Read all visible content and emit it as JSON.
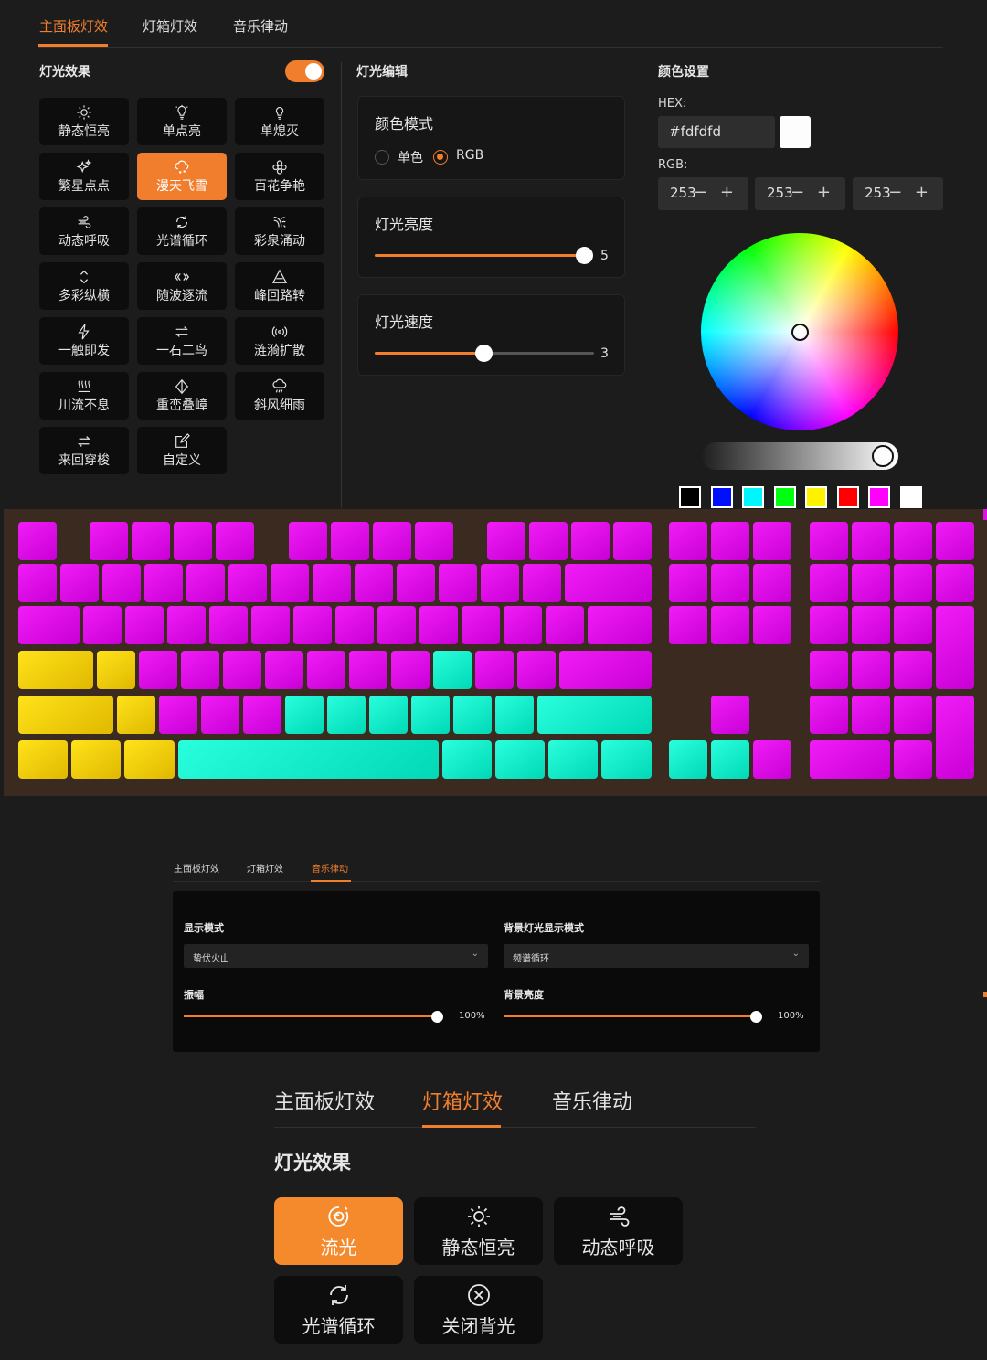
{
  "colors": {
    "accent": "#f07e2d",
    "magenta": "#e010ea",
    "cyan": "#1af0cf",
    "yellow": "#f5cf0a"
  },
  "main_panel": {
    "tabs": [
      {
        "label": "主面板灯效"
      },
      {
        "label": "灯箱灯效"
      },
      {
        "label": "音乐律动"
      }
    ],
    "active_tab": "主面板灯效",
    "effects": {
      "title": "灯光效果",
      "enabled": true,
      "items": [
        {
          "label": "静态恒亮",
          "icon": "sun-icon"
        },
        {
          "label": "单点亮",
          "icon": "bulb-icon"
        },
        {
          "label": "单熄灭",
          "icon": "bulb-off-icon"
        },
        {
          "label": "繁星点点",
          "icon": "sparkle-icon"
        },
        {
          "label": "漫天飞雪",
          "icon": "snow-cloud-icon",
          "active": true
        },
        {
          "label": "百花争艳",
          "icon": "flower-icon"
        },
        {
          "label": "动态呼吸",
          "icon": "wind-icon"
        },
        {
          "label": "光谱循环",
          "icon": "cycle-icon"
        },
        {
          "label": "彩泉涌动",
          "icon": "fountain-icon"
        },
        {
          "label": "多彩纵横",
          "icon": "up-down-icon"
        },
        {
          "label": "随波逐流",
          "icon": "wave-arrows-icon"
        },
        {
          "label": "峰回路转",
          "icon": "triangle-icon"
        },
        {
          "label": "一触即发",
          "icon": "lightning-icon"
        },
        {
          "label": "一石二鸟",
          "icon": "swap-arrows-icon"
        },
        {
          "label": "涟漪扩散",
          "icon": "ripple-icon"
        },
        {
          "label": "川流不息",
          "icon": "stream-icon"
        },
        {
          "label": "重峦叠嶂",
          "icon": "layers-icon"
        },
        {
          "label": "斜风细雨",
          "icon": "rain-cloud-icon"
        },
        {
          "label": "来回穿梭",
          "icon": "shuttle-icon"
        },
        {
          "label": "自定义",
          "icon": "edit-icon"
        }
      ]
    },
    "editor": {
      "title": "灯光编辑",
      "color_mode": {
        "title": "颜色模式",
        "options": [
          "单色",
          "RGB"
        ],
        "selected": "RGB"
      },
      "brightness": {
        "title": "灯光亮度",
        "value": "5",
        "fraction": 1.0
      },
      "speed": {
        "title": "灯光速度",
        "value": "3",
        "fraction": 0.5
      }
    },
    "color": {
      "title": "颜色设置",
      "hex_label": "HEX:",
      "hex_value": "#fdfdfd",
      "rgb_label": "RGB:",
      "r": "253",
      "g": "253",
      "b": "253",
      "stepper": "− +",
      "presets": [
        "#000000",
        "#0010ff",
        "#00f5ff",
        "#00ff10",
        "#fff200",
        "#ff0000",
        "#ff00ff",
        "#ffffff"
      ]
    }
  },
  "music_panel": {
    "tabs": [
      {
        "label": "主面板灯效"
      },
      {
        "label": "灯箱灯效"
      },
      {
        "label": "音乐律动"
      }
    ],
    "active_tab": "音乐律动",
    "display_mode": {
      "label": "显示模式",
      "value": "蛰伏火山"
    },
    "bg_mode": {
      "label": "背景灯光显示模式",
      "value": "频谱循环"
    },
    "amplitude": {
      "label": "振幅",
      "value": "100%"
    },
    "bg_brightness": {
      "label": "背景亮度",
      "value": "100%"
    }
  },
  "lightbox_panel": {
    "tabs": [
      {
        "label": "主面板灯效"
      },
      {
        "label": "灯箱灯效"
      },
      {
        "label": "音乐律动"
      }
    ],
    "active_tab": "灯箱灯效",
    "title": "灯光效果",
    "items": [
      {
        "label": "流光",
        "icon": "flow-icon",
        "active": true
      },
      {
        "label": "静态恒亮",
        "icon": "sun-icon"
      },
      {
        "label": "动态呼吸",
        "icon": "wind-icon"
      },
      {
        "label": "光谱循环",
        "icon": "cycle-icon"
      },
      {
        "label": "关闭背光",
        "icon": "close-circle-icon"
      }
    ]
  }
}
